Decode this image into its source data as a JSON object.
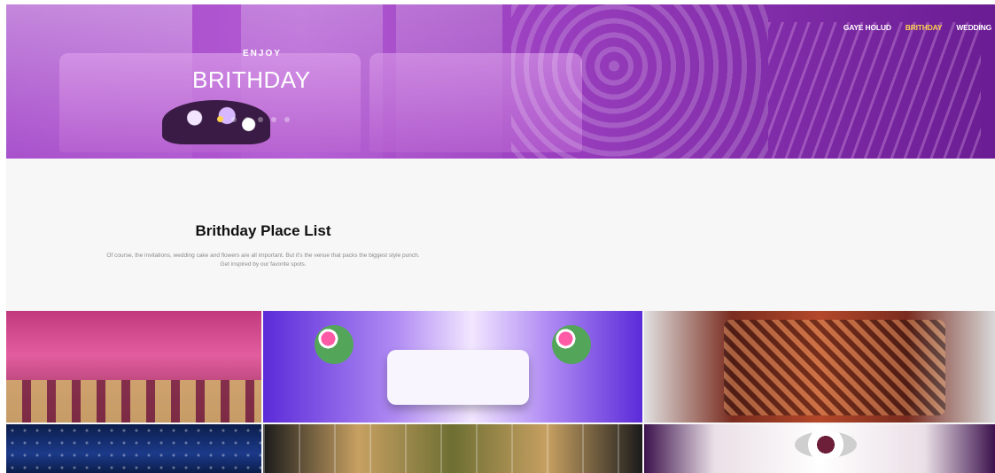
{
  "nav": {
    "items": [
      {
        "label": "GAYE HOLUD",
        "active": false
      },
      {
        "label": "BRITHDAY",
        "active": true
      },
      {
        "label": "WEDDING",
        "active": false
      }
    ]
  },
  "hero": {
    "eyebrow": "ENJOY",
    "title": "BRITHDAY",
    "slides": {
      "count": 6,
      "active_index": 0
    }
  },
  "section": {
    "title": "Brithday Place List",
    "description": "Of course, the invitations, wedding cake and flowers are all important. But it's the venue that packs the biggest style punch. Get inspired by our favorite spots."
  },
  "gallery": {
    "tiles": [
      {
        "name": "gallery-tile-1"
      },
      {
        "name": "gallery-tile-2"
      },
      {
        "name": "gallery-tile-3"
      },
      {
        "name": "gallery-tile-4"
      },
      {
        "name": "gallery-tile-5"
      },
      {
        "name": "gallery-tile-6"
      }
    ]
  },
  "colors": {
    "accent": "#ffd24d",
    "hero_purple": "#9a3fbf",
    "text_dark": "#111111",
    "text_muted": "#8a8a8a"
  }
}
